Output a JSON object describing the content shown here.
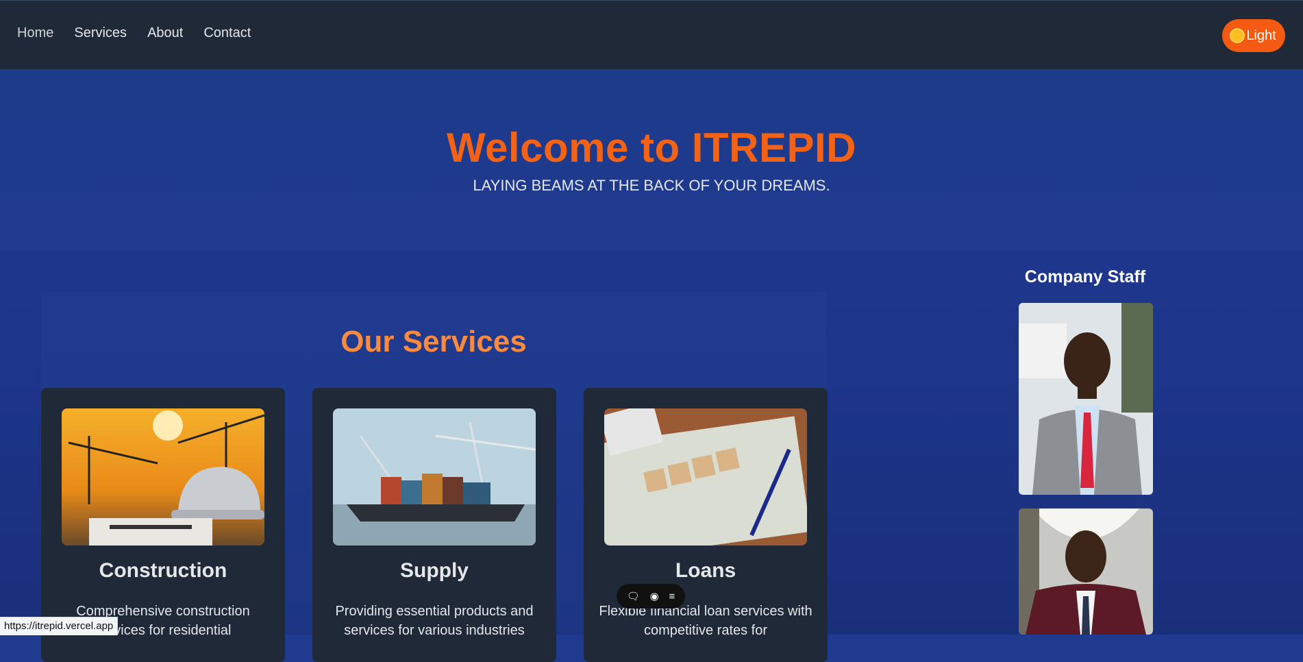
{
  "nav": {
    "items": [
      "Home",
      "Services",
      "About",
      "Contact"
    ],
    "theme_toggle_label": "Light"
  },
  "hero": {
    "title": "Welcome to ITREPID",
    "tagline": "LAYING BEAMS AT THE BACK OF YOUR DREAMS."
  },
  "services": {
    "heading": "Our Services",
    "cards": [
      {
        "title": "Construction",
        "description": "Comprehensive construction services for residential"
      },
      {
        "title": "Supply",
        "description": "Providing essential products and services for various industries"
      },
      {
        "title": "Loans",
        "description": "Flexible financial loan services with competitive rates for"
      }
    ]
  },
  "staff": {
    "heading": "Company Staff"
  },
  "status_bar": {
    "url": "https://itrepid.vercel.app"
  },
  "colors": {
    "brand_orange": "#f46315",
    "navbar_bg": "#1f2937",
    "hero_bg": "#1e3a8a"
  }
}
